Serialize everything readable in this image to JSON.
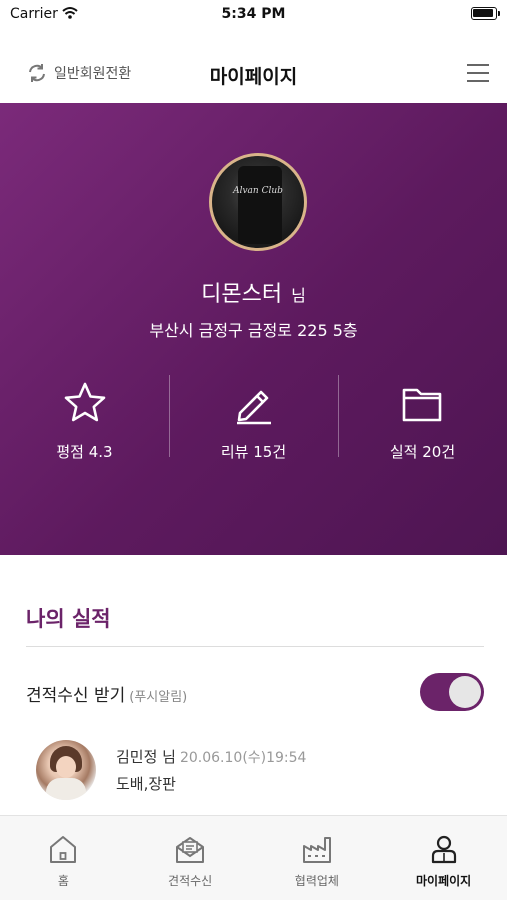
{
  "status_bar": {
    "carrier": "Carrier",
    "time": "5:34 PM",
    "icons": [
      "wifi-icon",
      "battery-icon"
    ]
  },
  "header": {
    "switch_label": "일반회원전환",
    "switch_icon": "refresh-icon",
    "title": "마이페이지",
    "menu_icon": "menu-icon"
  },
  "profile": {
    "name": "디몬스터",
    "name_suffix": "님",
    "address": "부산시 금정구 금정로 225 5층",
    "avatar_caption": "Alvan Club",
    "stats": [
      {
        "icon": "star-icon",
        "label": "평점 4.3"
      },
      {
        "icon": "pencil-icon",
        "label": "리뷰 15건"
      },
      {
        "icon": "folder-icon",
        "label": "실적 20건"
      }
    ]
  },
  "my_records": {
    "title": "나의 실적",
    "toggle_label": "견적수신 받기",
    "toggle_sub": "(푸시알림)",
    "toggle_on": true,
    "items": [
      {
        "name": "김민정 님",
        "date": "20.06.10(수)19:54",
        "category": "도배,장판"
      }
    ]
  },
  "tabs": [
    {
      "label": "홈",
      "icon": "home-icon",
      "active": false
    },
    {
      "label": "견적수신",
      "icon": "mail-icon",
      "active": false
    },
    {
      "label": "협력업체",
      "icon": "factory-icon",
      "active": false
    },
    {
      "label": "마이페이지",
      "icon": "user-icon",
      "active": true
    }
  ],
  "colors": {
    "accent": "#6b2369",
    "profile_bg": "#5d1a5e",
    "toggle_knob": "#e6e6e6"
  }
}
